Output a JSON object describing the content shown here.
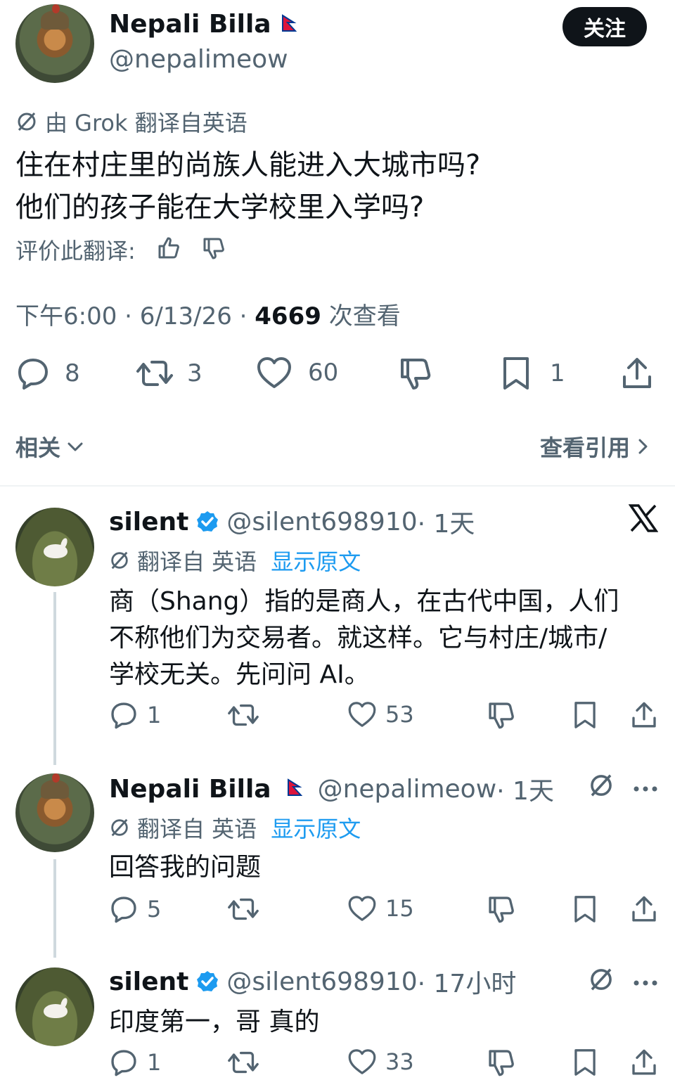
{
  "main_tweet": {
    "author_name": "Nepali Billa",
    "author_handle": "@nepalimeow",
    "follow_label": "关注",
    "translation_note": "由 Grok 翻译自英语",
    "text_line1": "住在村庄里的尚族人能进入大城市吗?",
    "text_line2": "他们的孩子能在大学校里入学吗?",
    "rate_label": "评价此翻译:",
    "meta_time": "下午6:00 · 6/13/26 · ",
    "views_count": "4669",
    "views_label": " 次查看",
    "replies": "8",
    "retweets": "3",
    "likes": "60",
    "bookmarks": "1",
    "related_label": "相关",
    "view_quotes_label": "查看引用"
  },
  "replies": [
    {
      "author_name": "silent",
      "author_handle": "@silent698910",
      "time": " · 1天",
      "translated_label": "翻译自 英语",
      "show_original": "显示原文",
      "text_line1": "商（Shang）指的是商人，在古代中国，人们",
      "text_line2": "不称他们为交易者。就这样。它与村庄/城市/",
      "text_line3": "学校无关。先问问 AI。",
      "replies": "1",
      "likes": "53"
    },
    {
      "author_name": "Nepali Billa",
      "author_handle": "@nepalimeow",
      "time": " · 1天",
      "translated_label": "翻译自 英语",
      "show_original": "显示原文",
      "text_line1": "回答我的问题",
      "replies": "5",
      "likes": "15"
    },
    {
      "author_name": "silent",
      "author_handle": "@silent698910",
      "time": " · 17小时",
      "text_line1": "印度第一，哥 真的",
      "replies": "1",
      "likes": "33"
    }
  ],
  "icons": {
    "reply": "reply-icon",
    "retweet": "retweet-icon",
    "like": "heart-icon",
    "dislike": "thumbs-down-icon",
    "bookmark": "bookmark-icon",
    "share": "share-icon",
    "translate": "translate-icon",
    "more": "more-icon",
    "close": "x-logo-icon"
  },
  "colors": {
    "accent": "#1d9bf0",
    "text": "#0f1419",
    "muted": "#536471"
  }
}
